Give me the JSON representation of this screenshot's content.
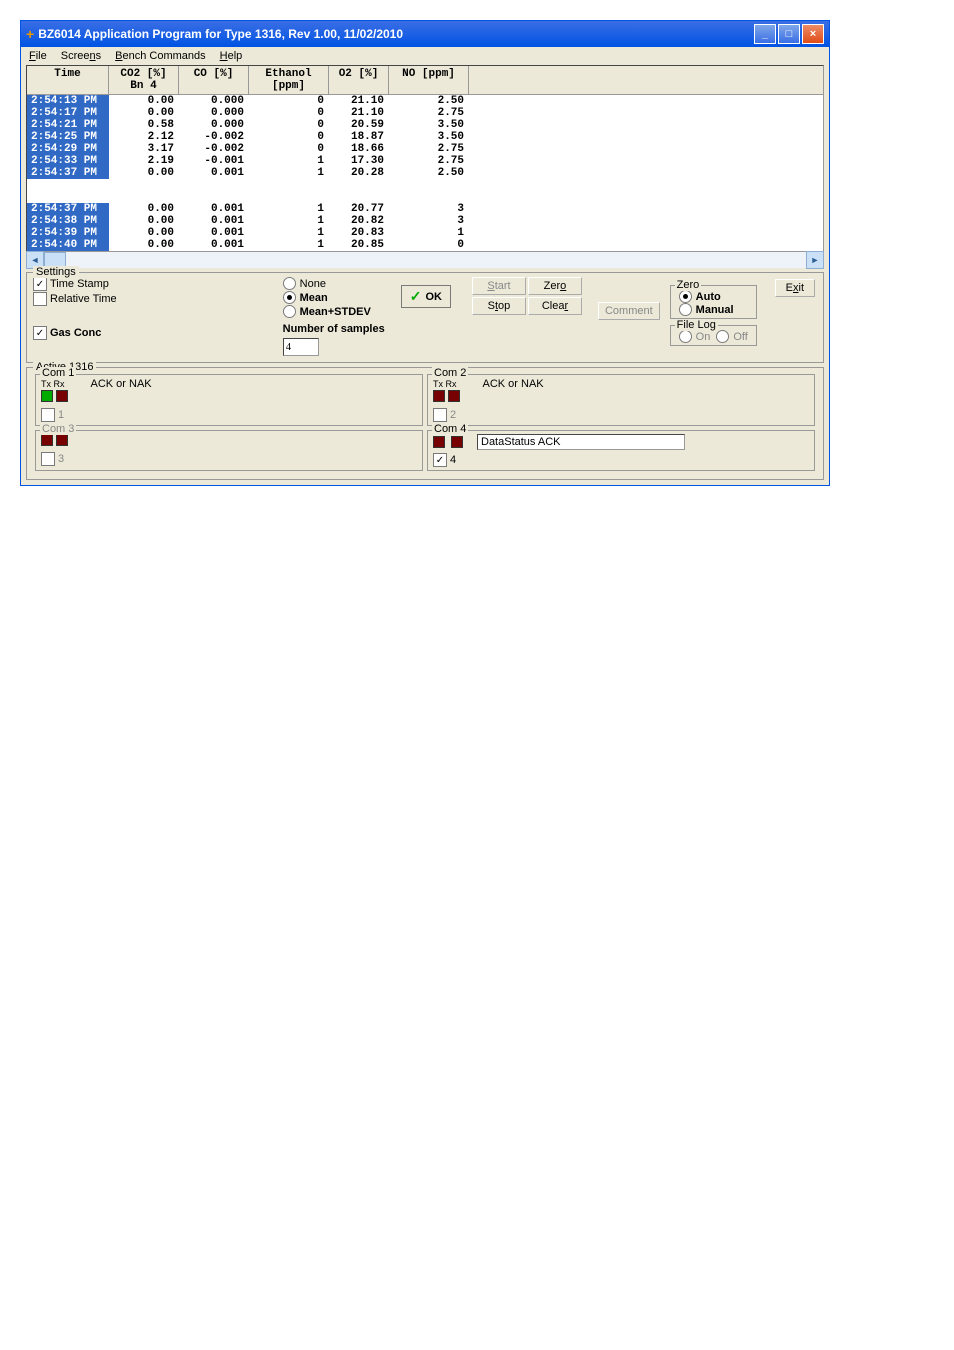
{
  "title": "BZ6014 Application Program for Type 1316, Rev 1.00, 11/02/2010",
  "menu": {
    "file": "File",
    "screens": "Screens",
    "bench": "Bench Commands",
    "help": "Help"
  },
  "headers": {
    "time": "Time",
    "co2": "CO2 [%]",
    "co2_sub": "Bn 4",
    "co": "CO [%]",
    "eth": "Ethanol [ppm]",
    "o2": "O2 [%]",
    "no": "NO [ppm]"
  },
  "rows": [
    {
      "time": "2:54:13 PM",
      "co2": "0.00",
      "co": "0.000",
      "eth": "0",
      "o2": "21.10",
      "no": "2.50"
    },
    {
      "time": "2:54:17 PM",
      "co2": "0.00",
      "co": "0.000",
      "eth": "0",
      "o2": "21.10",
      "no": "2.75"
    },
    {
      "time": "2:54:21 PM",
      "co2": "0.58",
      "co": "0.000",
      "eth": "0",
      "o2": "20.59",
      "no": "3.50"
    },
    {
      "time": "2:54:25 PM",
      "co2": "2.12",
      "co": "-0.002",
      "eth": "0",
      "o2": "18.87",
      "no": "3.50"
    },
    {
      "time": "2:54:29 PM",
      "co2": "3.17",
      "co": "-0.002",
      "eth": "0",
      "o2": "18.66",
      "no": "2.75"
    },
    {
      "time": "2:54:33 PM",
      "co2": "2.19",
      "co": "-0.001",
      "eth": "1",
      "o2": "17.30",
      "no": "2.75"
    },
    {
      "time": "2:54:37 PM",
      "co2": "0.00",
      "co": "0.001",
      "eth": "1",
      "o2": "20.28",
      "no": "2.50"
    }
  ],
  "rows2": [
    {
      "time": "2:54:37 PM",
      "co2": "0.00",
      "co": "0.001",
      "eth": "1",
      "o2": "20.77",
      "no": "3"
    },
    {
      "time": "2:54:38 PM",
      "co2": "0.00",
      "co": "0.001",
      "eth": "1",
      "o2": "20.82",
      "no": "3"
    },
    {
      "time": "2:54:39 PM",
      "co2": "0.00",
      "co": "0.001",
      "eth": "1",
      "o2": "20.83",
      "no": "1"
    },
    {
      "time": "2:54:40 PM",
      "co2": "0.00",
      "co": "0.001",
      "eth": "1",
      "o2": "20.85",
      "no": "0"
    }
  ],
  "settings": {
    "title": "Settings",
    "timestamp": "Time Stamp",
    "reltime": "Relative Time",
    "gasconc": "Gas Conc",
    "none": "None",
    "mean": "Mean",
    "meanstdev": "Mean+STDEV",
    "numsamples": "Number of samples",
    "numsamples_val": "4",
    "ok": "OK",
    "start": "Start",
    "zero": "Zero",
    "stop": "Stop",
    "clear": "Clear",
    "comment": "Comment",
    "zerobox": "Zero",
    "auto": "Auto",
    "manual": "Manual",
    "filelog": "File Log",
    "on": "On",
    "off": "Off",
    "exit": "Exit"
  },
  "active1316": {
    "title": "Active 1316",
    "com1": "Com 1",
    "com2": "Com 2",
    "com3": "Com 3",
    "com4": "Com 4",
    "txrx": "Tx Rx",
    "ack": "ACK or NAK",
    "datastatus": "DataStatus ACK",
    "n1": "1",
    "n2": "2",
    "n3": "3",
    "n4": "4"
  }
}
